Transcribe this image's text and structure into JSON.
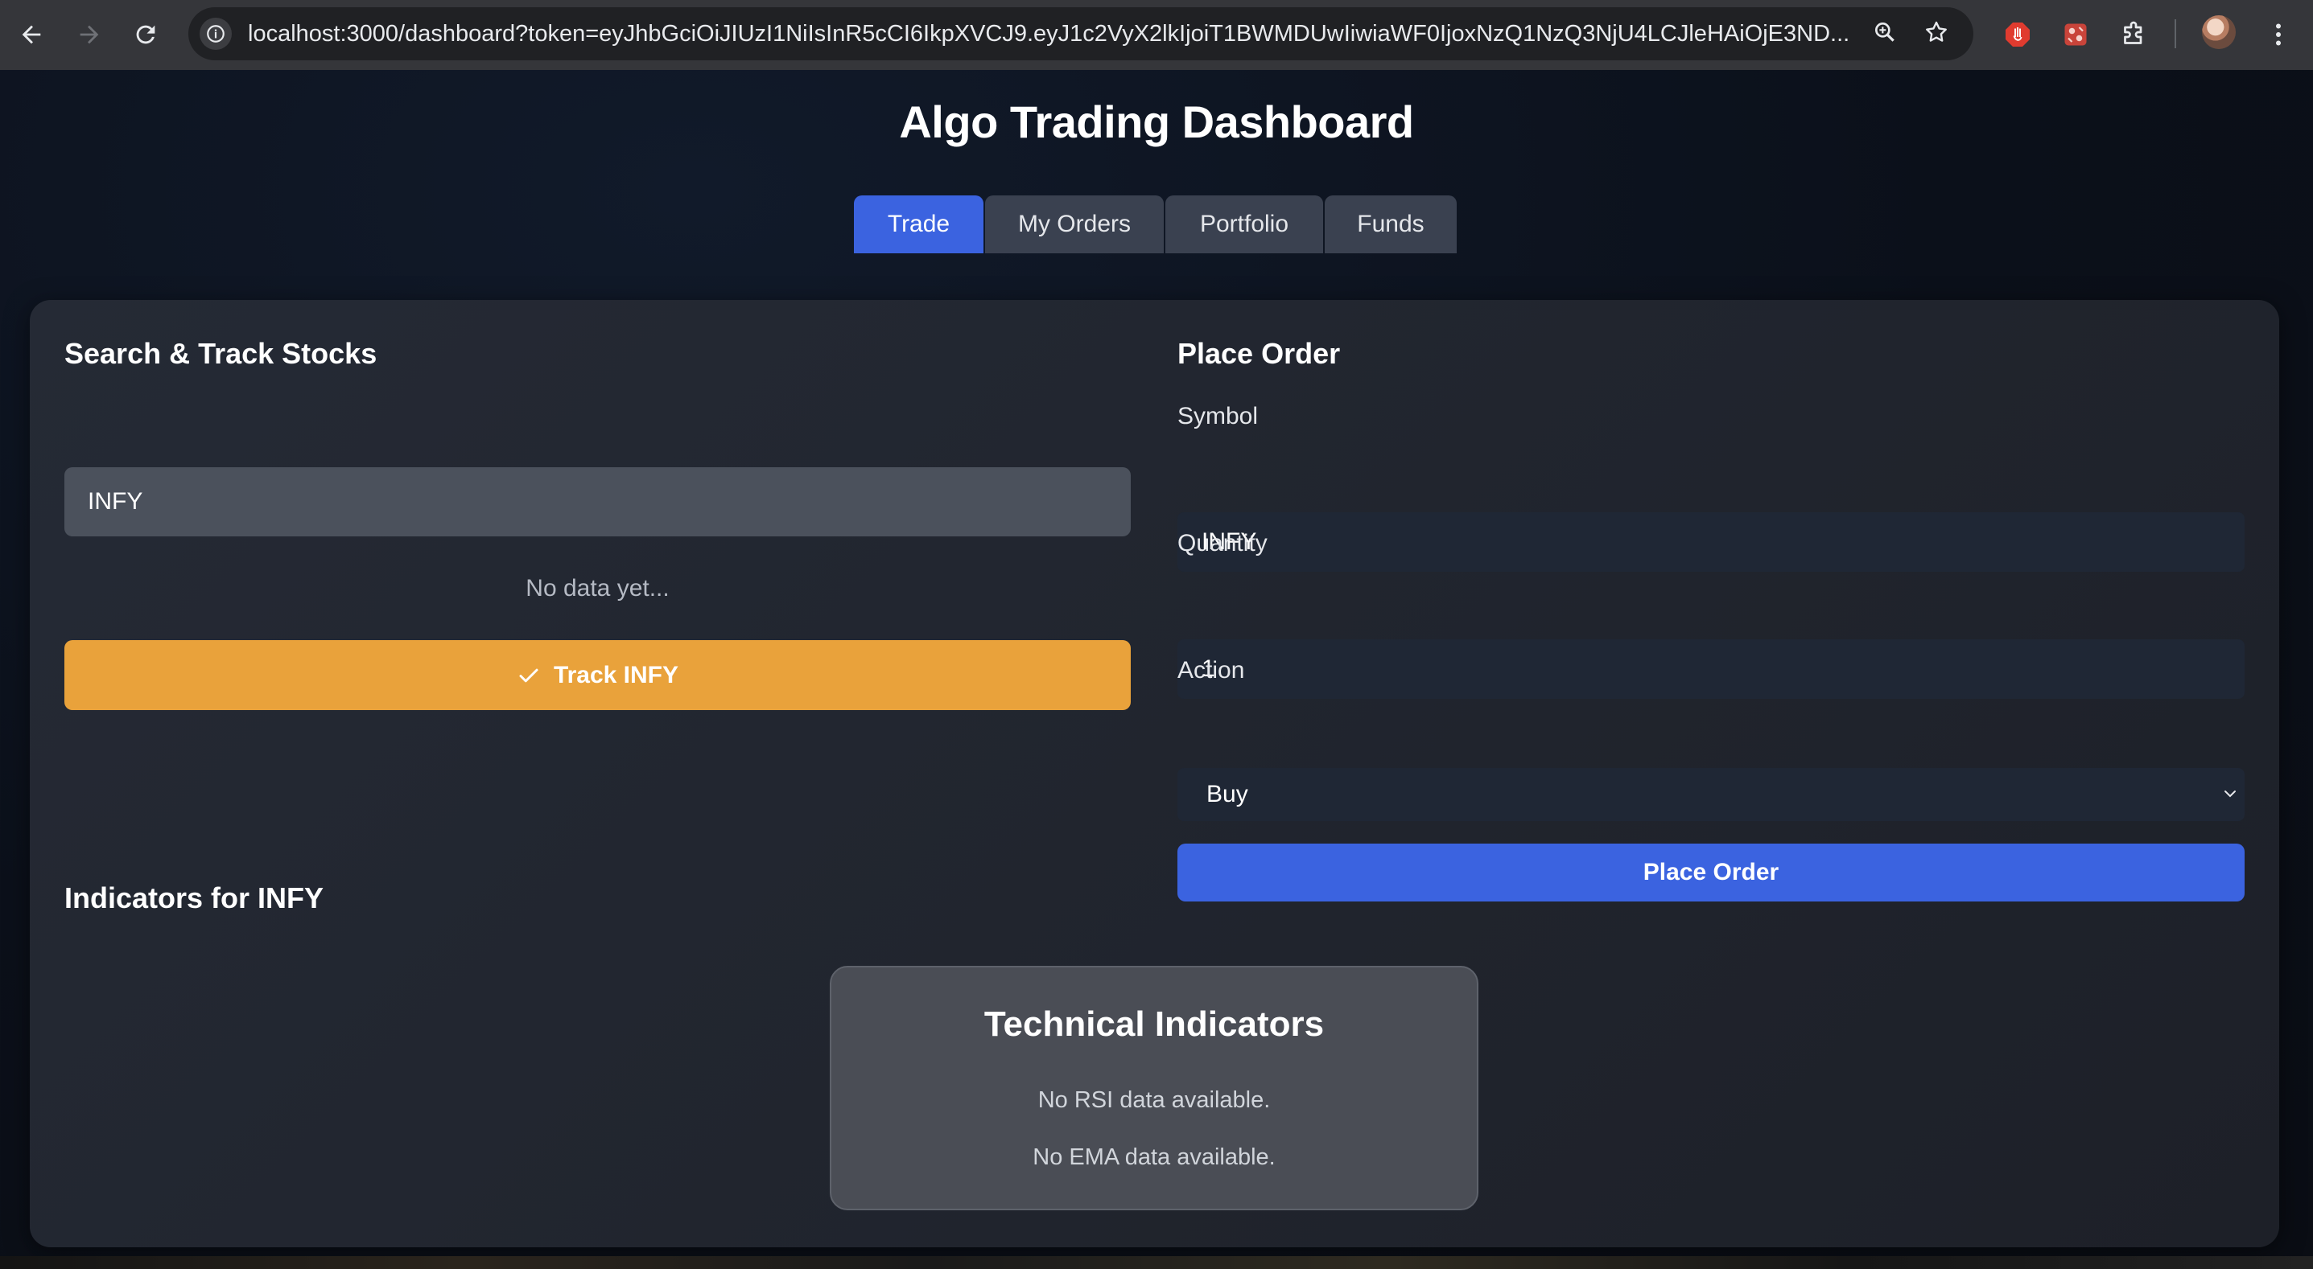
{
  "browser": {
    "url": "localhost:3000/dashboard?token=eyJhbGciOiJIUzI1NiIsInR5cCI6IkpXVCJ9.eyJ1c2VyX2lkIjoiT1BWMDUwIiwiaWF0IjoxNzQ1NzQ3NjU4LCJleHAiOjE3ND..."
  },
  "header": {
    "title": "Algo Trading Dashboard"
  },
  "tabs": [
    {
      "label": "Trade",
      "active": true
    },
    {
      "label": "My Orders",
      "active": false
    },
    {
      "label": "Portfolio",
      "active": false
    },
    {
      "label": "Funds",
      "active": false
    }
  ],
  "search": {
    "title": "Search & Track Stocks",
    "input_value": "INFY",
    "no_data_text": "No data yet...",
    "track_button_label": "Track INFY"
  },
  "order": {
    "title": "Place Order",
    "symbol_label": "Symbol",
    "symbol_value": "INFY",
    "quantity_label": "Quantity",
    "quantity_value": "1",
    "action_label": "Action",
    "action_value": "Buy",
    "submit_label": "Place Order"
  },
  "indicators": {
    "title": "Indicators for INFY",
    "card_title": "Technical Indicators",
    "rsi_message": "No RSI data available.",
    "ema_message": "No EMA data available."
  },
  "colors": {
    "accent_blue": "#3b63e0",
    "track_orange": "#e9a23b",
    "tab_inactive": "#3a4150",
    "card_bg": "#252a35"
  }
}
